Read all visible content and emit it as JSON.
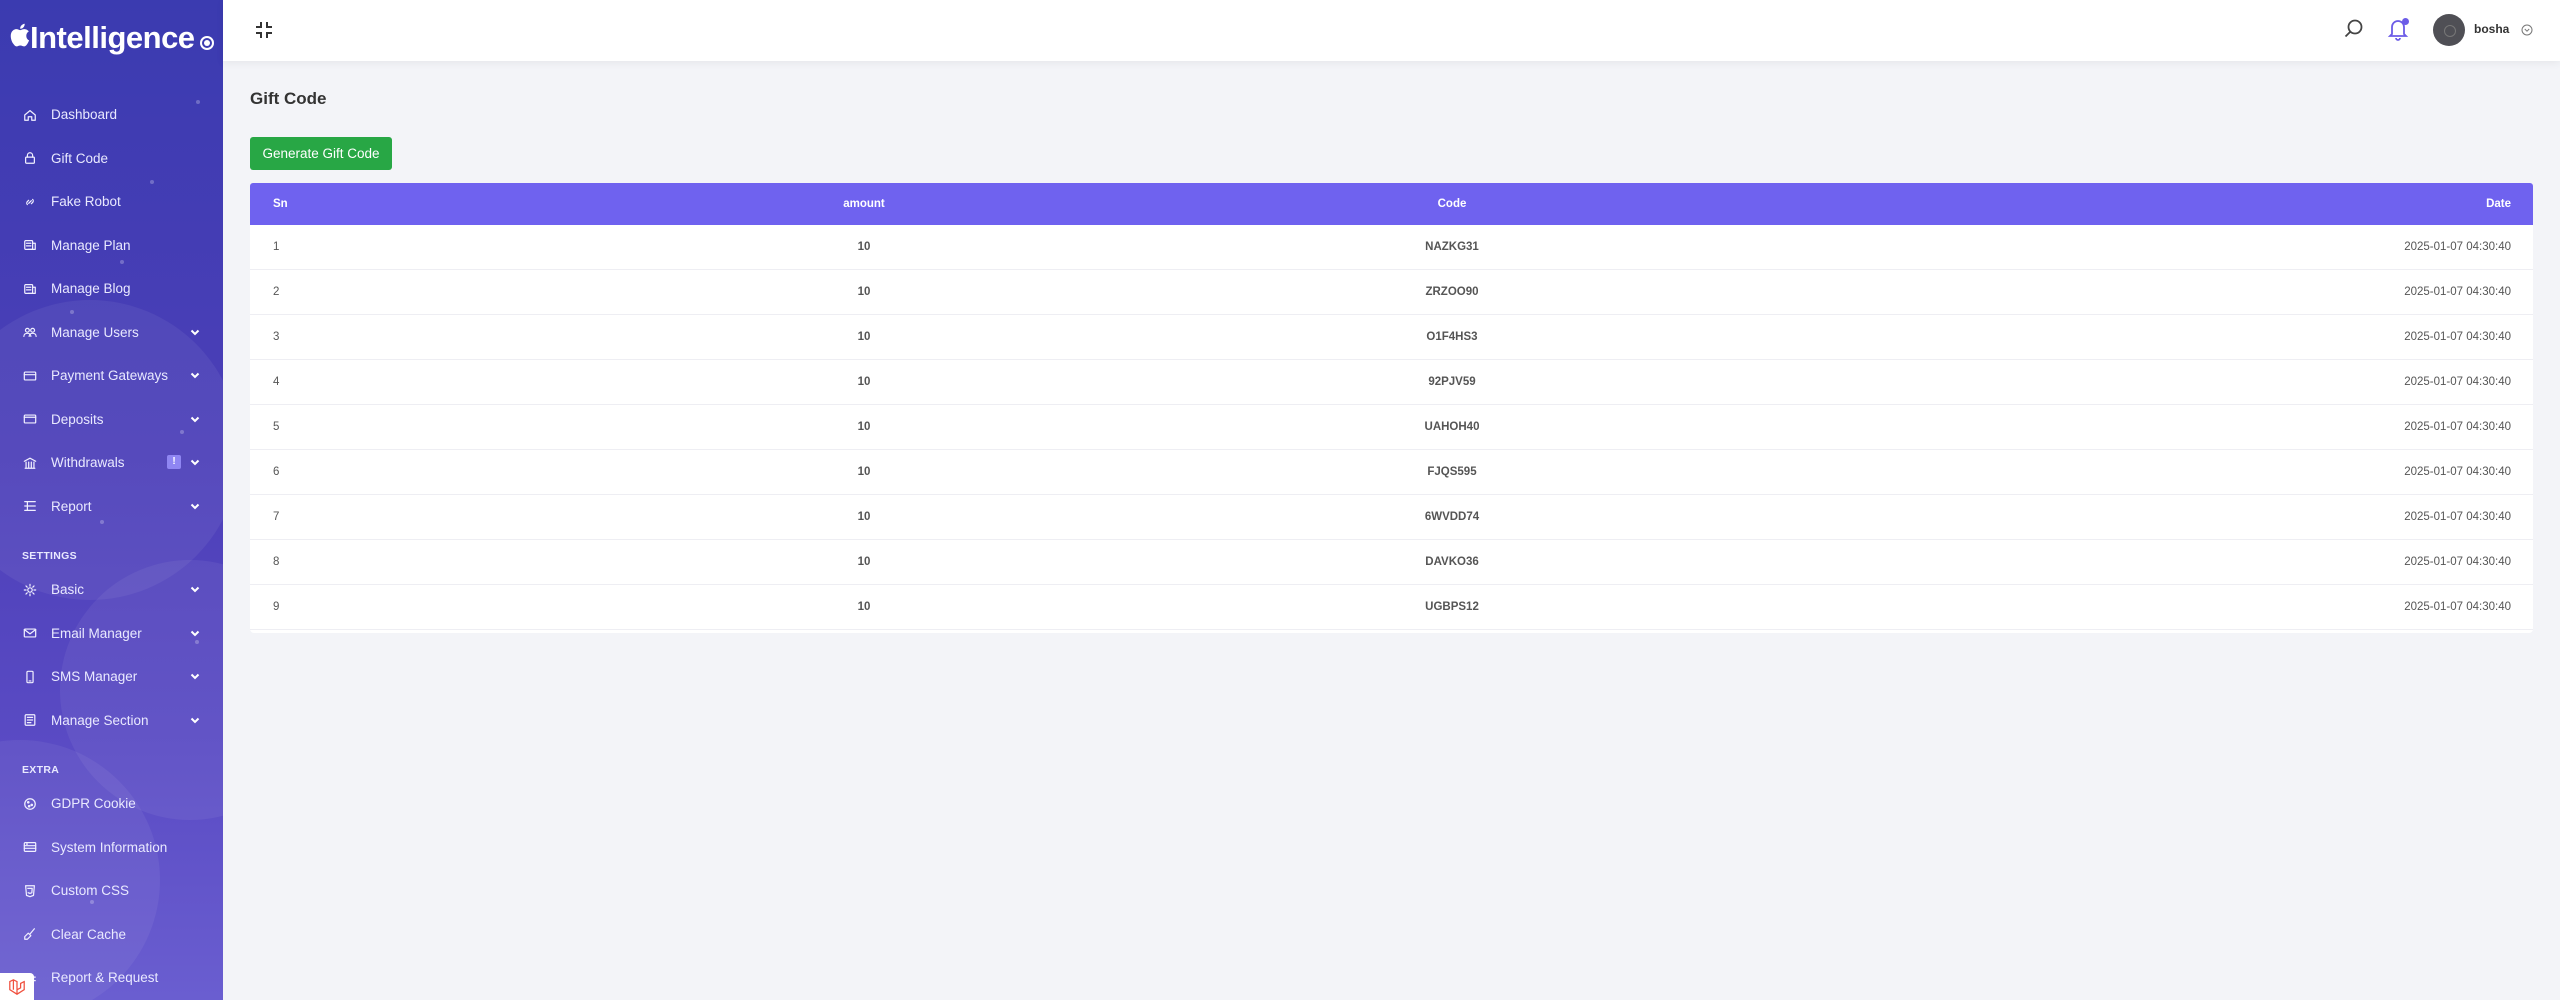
{
  "app": {
    "logo_text": "Intelligence"
  },
  "sidebar": {
    "items": [
      {
        "label": "Dashboard",
        "icon": "home-icon",
        "has_chevron": false
      },
      {
        "label": "Gift Code",
        "icon": "lock-icon",
        "has_chevron": false
      },
      {
        "label": "Fake Robot",
        "icon": "link-icon",
        "has_chevron": false
      },
      {
        "label": "Manage Plan",
        "icon": "layers-icon",
        "has_chevron": false
      },
      {
        "label": "Manage Blog",
        "icon": "layers-icon",
        "has_chevron": false
      },
      {
        "label": "Manage Users",
        "icon": "users-icon",
        "has_chevron": true
      },
      {
        "label": "Payment Gateways",
        "icon": "credit-card-icon",
        "has_chevron": true
      },
      {
        "label": "Deposits",
        "icon": "wallet-icon",
        "has_chevron": true
      },
      {
        "label": "Withdrawals",
        "icon": "bank-icon",
        "has_chevron": true,
        "badge": "!"
      },
      {
        "label": "Report",
        "icon": "list-icon",
        "has_chevron": true
      }
    ],
    "settings_label": "SETTINGS",
    "settings_items": [
      {
        "label": "Basic",
        "icon": "gear-icon",
        "has_chevron": true
      },
      {
        "label": "Email Manager",
        "icon": "mail-icon",
        "has_chevron": true
      },
      {
        "label": "SMS Manager",
        "icon": "phone-icon",
        "has_chevron": true
      },
      {
        "label": "Manage Section",
        "icon": "section-icon",
        "has_chevron": true
      }
    ],
    "extra_label": "EXTRA",
    "extra_items": [
      {
        "label": "GDPR Cookie",
        "icon": "cookie-icon",
        "has_chevron": false
      },
      {
        "label": "System Information",
        "icon": "server-icon",
        "has_chevron": false
      },
      {
        "label": "Custom CSS",
        "icon": "css-icon",
        "has_chevron": false
      },
      {
        "label": "Clear Cache",
        "icon": "broom-icon",
        "has_chevron": false
      },
      {
        "label": "Report & Request",
        "icon": "bug-icon",
        "has_chevron": false
      }
    ]
  },
  "topbar": {
    "username": "bosha"
  },
  "main": {
    "title": "Gift Code",
    "generate_button": "Generate Gift Code",
    "table": {
      "columns": [
        "Sn",
        "amount",
        "Code",
        "Date"
      ],
      "rows": [
        {
          "sn": "1",
          "amount": "10",
          "code": "NAZKG31",
          "date": "2025-01-07 04:30:40"
        },
        {
          "sn": "2",
          "amount": "10",
          "code": "ZRZOO90",
          "date": "2025-01-07 04:30:40"
        },
        {
          "sn": "3",
          "amount": "10",
          "code": "O1F4HS3",
          "date": "2025-01-07 04:30:40"
        },
        {
          "sn": "4",
          "amount": "10",
          "code": "92PJV59",
          "date": "2025-01-07 04:30:40"
        },
        {
          "sn": "5",
          "amount": "10",
          "code": "UAHOH40",
          "date": "2025-01-07 04:30:40"
        },
        {
          "sn": "6",
          "amount": "10",
          "code": "FJQS595",
          "date": "2025-01-07 04:30:40"
        },
        {
          "sn": "7",
          "amount": "10",
          "code": "6WVDD74",
          "date": "2025-01-07 04:30:40"
        },
        {
          "sn": "8",
          "amount": "10",
          "code": "DAVKO36",
          "date": "2025-01-07 04:30:40"
        },
        {
          "sn": "9",
          "amount": "10",
          "code": "UGBPS12",
          "date": "2025-01-07 04:30:40"
        }
      ]
    }
  },
  "colors": {
    "sidebar_top": "#3b3bb0",
    "sidebar_bottom": "#6a5ed0",
    "table_header": "#6f62ef",
    "primary_button": "#28a745",
    "notification_dot": "#6c5ce7"
  }
}
